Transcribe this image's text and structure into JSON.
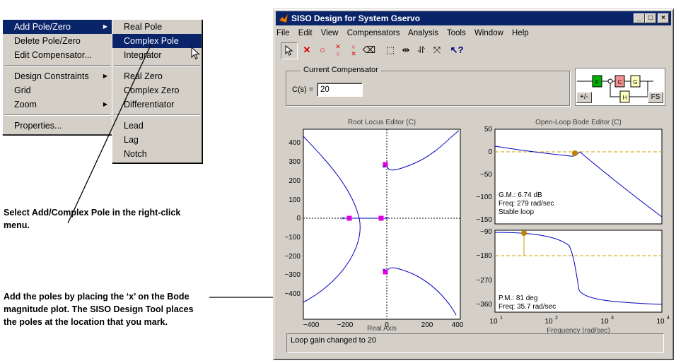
{
  "context_menu": {
    "items": [
      {
        "label": "Add Pole/Zero",
        "has_submenu": true
      },
      {
        "label": "Delete Pole/Zero"
      },
      {
        "label": "Edit Compensator..."
      },
      {
        "label": "Design Constraints",
        "has_submenu": true
      },
      {
        "label": "Grid"
      },
      {
        "label": "Zoom",
        "has_submenu": true
      },
      {
        "label": "Properties..."
      }
    ]
  },
  "submenu": {
    "items": [
      "Real Pole",
      "Complex Pole",
      "Integrator",
      "Real Zero",
      "Complex Zero",
      "Differentiator",
      "Lead",
      "Lag",
      "Notch"
    ]
  },
  "annotations": {
    "select_note": "Select Add/Complex Pole in the right-click\nmenu.",
    "add_note": "Add the poles by placing the ‘x’ on the Bode\nmagnitude plot. The SISO Design Tool places\nthe poles at the location that you mark."
  },
  "window": {
    "title": "SISO Design for System Gservo",
    "controls": [
      "_",
      "□",
      "×"
    ],
    "menubar": [
      "File",
      "Edit",
      "View",
      "Compensators",
      "Analysis",
      "Tools",
      "Window",
      "Help"
    ],
    "tools": [
      "pointer-icon",
      "add-pole-icon",
      "add-zero-icon",
      "add-lead-icon",
      "add-lag-icon",
      "eraser-icon",
      "zoom-box-icon",
      "zoom-x-icon",
      "zoom-y-icon",
      "fit-icon",
      "help-icon"
    ],
    "compensator": {
      "group_label": "Current Compensator",
      "cs_label": "C(s) =",
      "cs_value": "20"
    },
    "diagram": {
      "blocks": [
        "F",
        "C",
        "G",
        "H"
      ],
      "sign_button": "+/-",
      "fs_button": "FS"
    },
    "root_locus": {
      "title": "Root Locus Editor (C)",
      "xlabel": "Real Axis",
      "yticks": [
        "400",
        "300",
        "200",
        "100",
        "0",
        "−100",
        "−200",
        "−300",
        "−400"
      ],
      "xticks": [
        "−400",
        "−200",
        "0",
        "200",
        "400"
      ]
    },
    "bode": {
      "title": "Open-Loop Bode Editor (C)",
      "mag_yticks": [
        "50",
        "0",
        "−50",
        "−100",
        "−150"
      ],
      "phase_yticks": [
        "−90",
        "−180",
        "−270",
        "−360"
      ],
      "xlabel": "Frequency (rad/sec)",
      "xticks": [
        "10",
        "10",
        "10",
        "10"
      ],
      "xtick_exps": [
        "1",
        "2",
        "3",
        "4"
      ],
      "gain_margin": "G.M.: 6.74 dB",
      "gm_freq": "Freq: 279 rad/sec",
      "stability": "Stable loop",
      "phase_margin": "P.M.: 81 deg",
      "pm_freq": "Freq: 35.7 rad/sec"
    },
    "status": "Loop gain changed to 20"
  },
  "colors": {
    "titlebar": "#0a246a",
    "curve": "#0000c0",
    "marker": "#e000e0",
    "margin_line": "#c8a000"
  }
}
